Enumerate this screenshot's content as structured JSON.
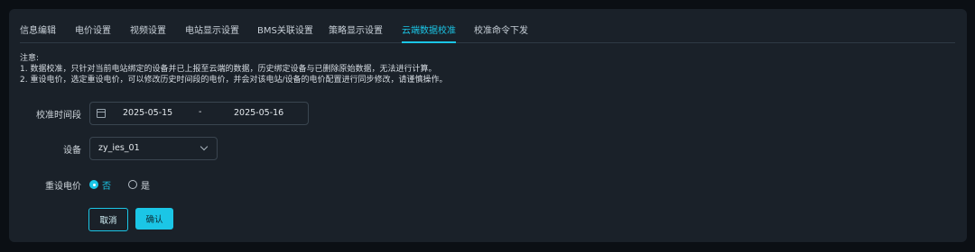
{
  "tabs": [
    {
      "label": "信息编辑"
    },
    {
      "label": "电价设置"
    },
    {
      "label": "视频设置"
    },
    {
      "label": "电站显示设置"
    },
    {
      "label": "BMS关联设置"
    },
    {
      "label": "策略显示设置"
    },
    {
      "label": "云端数据校准"
    },
    {
      "label": "校准命令下发"
    }
  ],
  "active_tab": "云端数据校准",
  "notes": {
    "title": "注意:",
    "line1": "1. 数据校准，只针对当前电站绑定的设备并已上报至云端的数据，历史绑定设备与已删除原始数据，无法进行计算。",
    "line2": "2. 重设电价，选定重设电价，可以修改历史时间段的电价，并会对该电站/设备的电价配置进行同步修改，请谨慎操作。"
  },
  "form": {
    "date_label": "校准时间段",
    "date_start": "2025-05-15",
    "date_sep": "-",
    "date_end": "2025-05-16",
    "device_label": "设备",
    "device_value": "zy_ies_01",
    "reset_label": "重设电价",
    "option_no": "否",
    "option_yes": "是",
    "reset_selected": "否"
  },
  "buttons": {
    "cancel": "取消",
    "confirm": "确认"
  },
  "colors": {
    "accent": "#1bc6e6",
    "panel": "#1a2129",
    "background": "#0b0f14"
  },
  "icons": {
    "date": "calendar-icon",
    "select": "chevron-down-icon"
  }
}
